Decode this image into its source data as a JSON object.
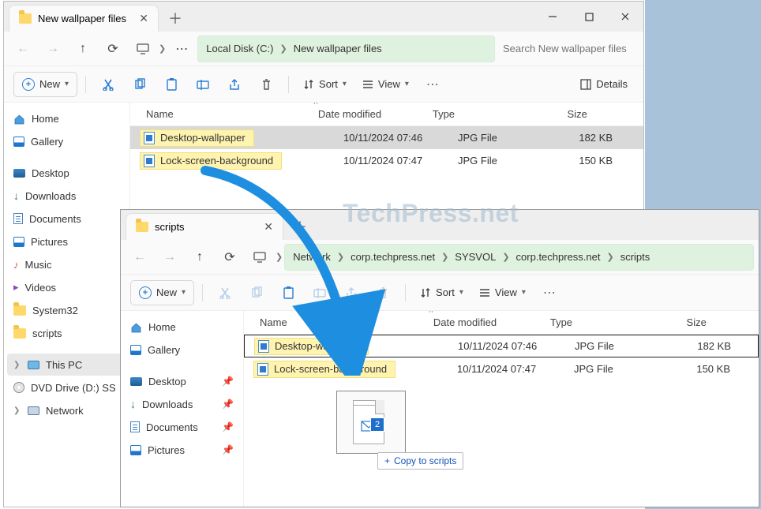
{
  "watermark": "TechPress.net",
  "drag": {
    "count": "2",
    "label": "Copy to scripts",
    "plus": "+"
  },
  "win1": {
    "tab_title": "New wallpaper files",
    "breadcrumb": [
      "Local Disk (C:)",
      "New wallpaper files"
    ],
    "search_placeholder": "Search New wallpaper files",
    "new_label": "New",
    "sort_label": "Sort",
    "view_label": "View",
    "details_label": "Details",
    "columns": {
      "name": "Name",
      "date": "Date modified",
      "type": "Type",
      "size": "Size"
    },
    "rows": [
      {
        "name": "Desktop-wallpaper",
        "date": "10/11/2024 07:46",
        "type": "JPG File",
        "size": "182 KB",
        "selected": true
      },
      {
        "name": "Lock-screen-background",
        "date": "10/11/2024 07:47",
        "type": "JPG File",
        "size": "150 KB",
        "selected": false
      }
    ],
    "nav": {
      "home": "Home",
      "gallery": "Gallery",
      "desktop": "Desktop",
      "downloads": "Downloads",
      "documents": "Documents",
      "pictures": "Pictures",
      "music": "Music",
      "videos": "Videos",
      "system32": "System32",
      "scripts": "scripts",
      "thispc": "This PC",
      "dvd": "DVD Drive (D:) SS",
      "network": "Network"
    }
  },
  "win2": {
    "tab_title": "scripts",
    "breadcrumb": [
      "Network",
      "corp.techpress.net",
      "SYSVOL",
      "corp.techpress.net",
      "scripts"
    ],
    "new_label": "New",
    "sort_label": "Sort",
    "view_label": "View",
    "columns": {
      "name": "Name",
      "date": "Date modified",
      "type": "Type",
      "size": "Size"
    },
    "rows": [
      {
        "name": "Desktop-wallpaper",
        "date": "10/11/2024 07:46",
        "type": "JPG File",
        "size": "182 KB",
        "selected": true
      },
      {
        "name": "Lock-screen-background",
        "date": "10/11/2024 07:47",
        "type": "JPG File",
        "size": "150 KB",
        "selected": false
      }
    ],
    "nav": {
      "home": "Home",
      "gallery": "Gallery",
      "desktop": "Desktop",
      "downloads": "Downloads",
      "documents": "Documents",
      "pictures": "Pictures"
    }
  }
}
